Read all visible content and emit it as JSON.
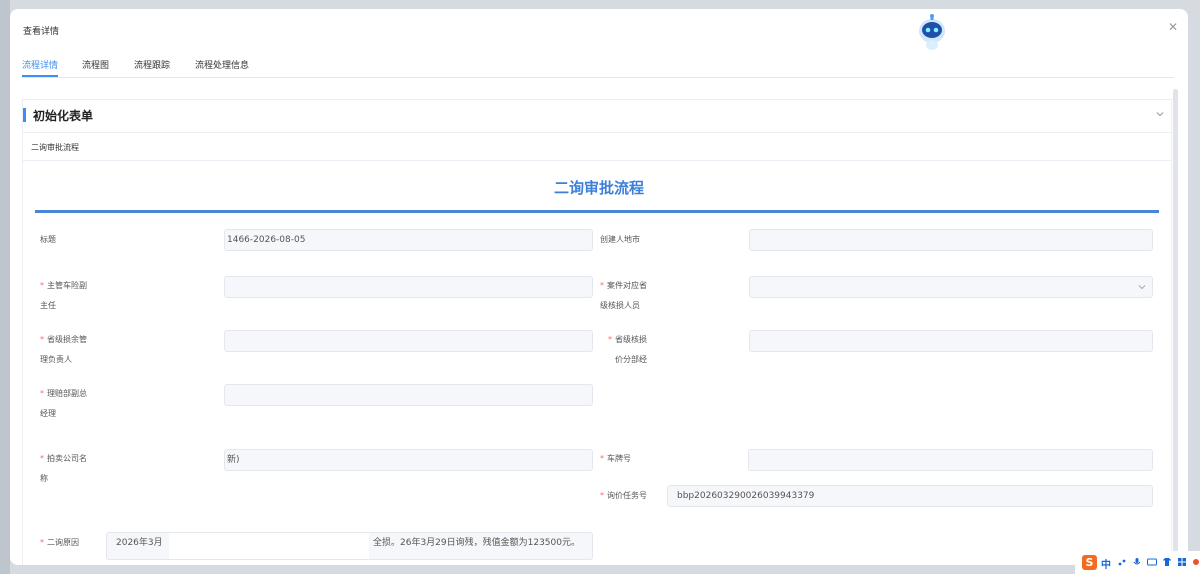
{
  "modal": {
    "title": "查看详情"
  },
  "tabs": [
    {
      "label": "流程详情",
      "active": true
    },
    {
      "label": "流程图",
      "active": false
    },
    {
      "label": "流程跟踪",
      "active": false
    },
    {
      "label": "流程处理信息",
      "active": false
    }
  ],
  "section": {
    "title": "初始化表单",
    "subsection": "二询审批流程"
  },
  "form": {
    "title": "二询审批流程",
    "fields": {
      "title_label": "标题",
      "title_value": "1466-2026-08-05",
      "creator_city_label": "创建人地市",
      "creator_city_value": "",
      "vehicle_deputy_label_1": "主管车险副",
      "vehicle_deputy_label_2": "主任",
      "vehicle_deputy_value": "",
      "case_adjuster_label_1": "案件对应省",
      "case_adjuster_label_2": "级核损人员",
      "case_adjuster_value": "",
      "residual_mgr_label_1": "省级损余管",
      "residual_mgr_label_2": "理负责人",
      "residual_mgr_value": "",
      "pricing_dept_label_1": "省级核损",
      "pricing_dept_label_2": "价分部经",
      "pricing_dept_value": "",
      "claims_gm_label_1": "理赔部副总",
      "claims_gm_label_2": "经理",
      "claims_gm_value": "",
      "auction_co_label_1": "拍卖公司名",
      "auction_co_label_2": "称",
      "auction_co_value": "新)",
      "plate_label": "车牌号",
      "plate_value": "",
      "inquiry_task_label": "询价任务号",
      "inquiry_task_value": "bbp20260329002603994337​9",
      "reason_label": "二询原因",
      "reason_value_1": "2026年3月",
      "reason_value_2": "全损。26年3月29日询残，残值金额为123500元。"
    }
  },
  "ime": {
    "text": "中"
  },
  "colors": {
    "accent": "#3d8ef0",
    "required": "#f56c6c",
    "title_blue": "#3d7fd9"
  }
}
